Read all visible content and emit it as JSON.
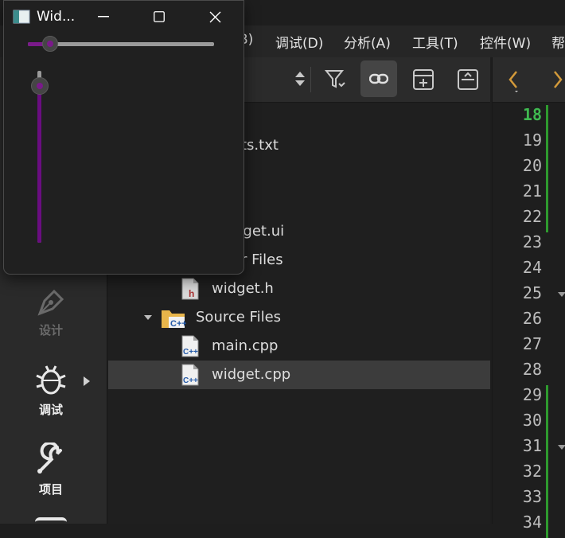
{
  "menubar": {
    "items": [
      "B)",
      "调试(D)",
      "分析(A)",
      "工具(T)",
      "控件(W)",
      "帮"
    ]
  },
  "modes": [
    {
      "label": "设计",
      "icon": "pen-nib-icon",
      "enabled": false
    },
    {
      "label": "调试",
      "icon": "bug-icon",
      "enabled": true
    },
    {
      "label": "项目",
      "icon": "wrench-icon",
      "enabled": true
    }
  ],
  "project_toolbar": {
    "buttons": [
      "sort-updown-icon",
      "filter-icon",
      "link-icon",
      "add-split-icon",
      "close-split-icon"
    ],
    "active": "link-icon"
  },
  "tree": {
    "rows": [
      {
        "text": "ts.txt",
        "indent": 0
      },
      {
        "text": "dget.ui",
        "indent": 0
      },
      {
        "text": "r Files",
        "indent": 0
      },
      {
        "text": "widget.h",
        "icon": "header-file-icon"
      },
      {
        "text": "Source Files",
        "icon": "source-folder-icon",
        "expanded": true
      },
      {
        "text": "main.cpp",
        "icon": "cpp-file-icon"
      },
      {
        "text": "widget.cpp",
        "icon": "cpp-file-icon",
        "selected": true
      }
    ]
  },
  "editor": {
    "current_line": 18,
    "line_numbers": [
      "18",
      "19",
      "20",
      "21",
      "22",
      "23",
      "24",
      "25",
      "26",
      "27",
      "28",
      "29",
      "30",
      "31",
      "32",
      "33",
      "34"
    ],
    "fold_lines": [
      "25",
      "31"
    ]
  },
  "widget_window": {
    "title": "Wid...",
    "minimize_label": "minimize",
    "horizontal_slider_value": 0.12,
    "vertical_slider_value": 0.91,
    "accent": "#7a1a8a"
  },
  "colors": {
    "accent": "#7a1a8a",
    "current_line": "#3fb950",
    "change_marker": "#2e9a2e"
  }
}
